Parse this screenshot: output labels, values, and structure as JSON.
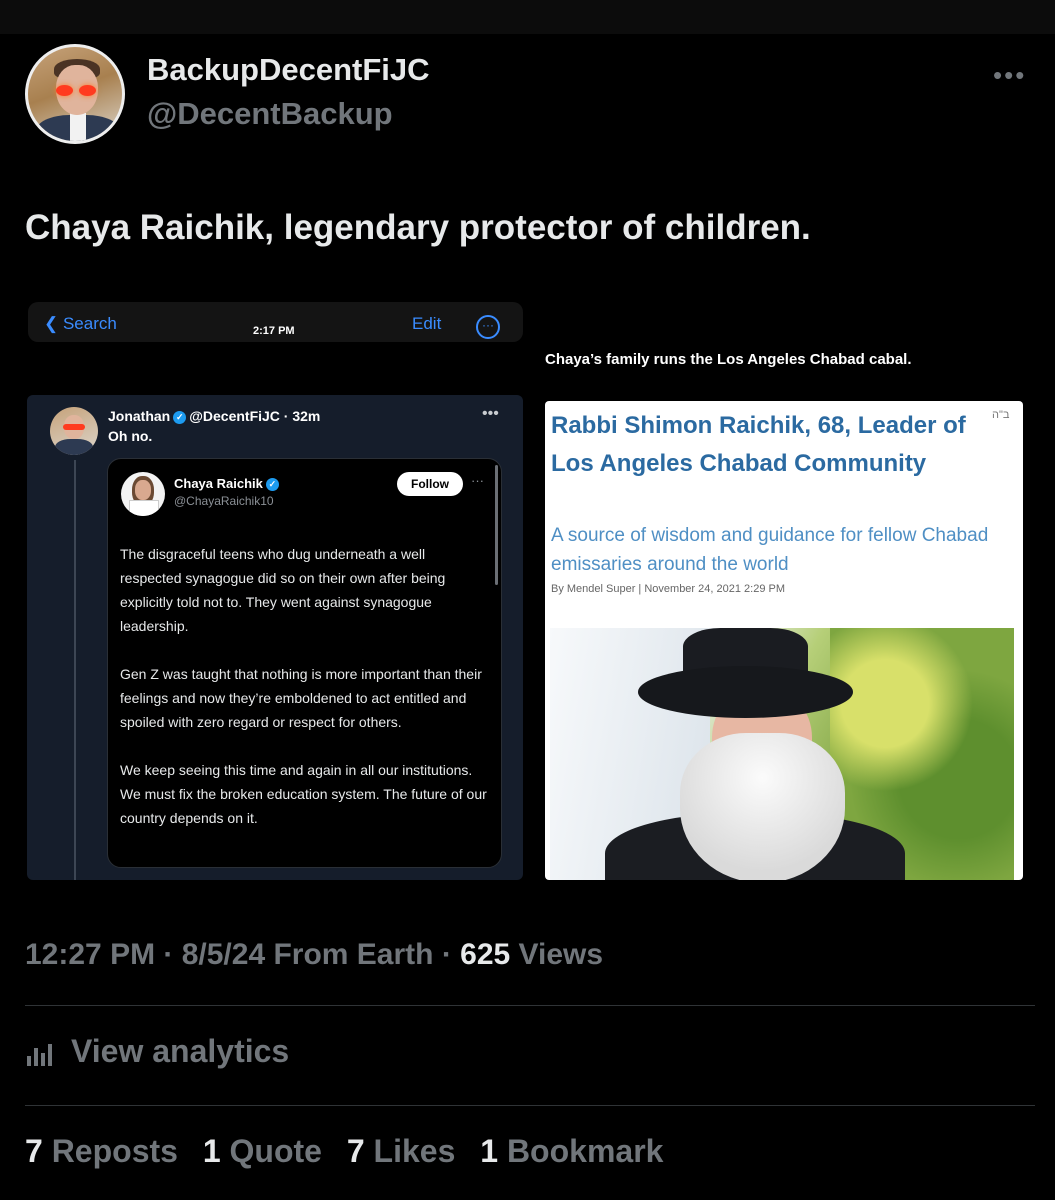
{
  "author": {
    "name": "BackupDecentFiJC",
    "handle": "@DecentBackup",
    "more_label": "•••"
  },
  "tweet": {
    "text": "Chaya Raichik, legendary protector of children."
  },
  "left_screenshot": {
    "ios_bar": {
      "back_label": "❮ Search",
      "time": "2:17 PM",
      "edit_label": "Edit",
      "more_label": "···"
    },
    "post": {
      "author": "Jonathan",
      "handle_time": "@DecentFiJC · 32m",
      "text": "Oh no.",
      "more_label": "•••",
      "quoted": {
        "name": "Chaya Raichik",
        "handle": "@ChayaRaichik10",
        "follow_label": "Follow",
        "more_label": "···",
        "paragraphs": [
          "The disgraceful teens who dug underneath a well respected synagogue did so on their own after being explicitly told not to. They went against synagogue leadership.",
          "Gen Z was taught that nothing is more important than their feelings and now they’re emboldened to act entitled and spoiled with zero regard or respect for others.",
          "We keep seeing this time and again in all our institutions. We must fix the broken education system. The future of our country depends on it."
        ]
      }
    }
  },
  "right_screenshot": {
    "caption": "Chaya’s family runs the Los Angeles Chabad cabal.",
    "article": {
      "title": "Rabbi Shimon Raichik, 68, Leader of Los Angeles Chabad Community",
      "mark": "ב\"ה",
      "subtitle": "A source of wisdom and guidance for fellow Chabad emissaries around the world",
      "byline": "By Mendel Super   |   November 24, 2021 2:29 PM"
    }
  },
  "meta": {
    "time_date_source": "12:27 PM · 8/5/24 From Earth · ",
    "views_count": "625",
    "views_label": " Views"
  },
  "analytics": {
    "label": "View analytics"
  },
  "stats": {
    "reposts_count": "7",
    "reposts_label": "Reposts",
    "quotes_count": "1",
    "quotes_label": "Quote",
    "likes_count": "7",
    "likes_label": "Likes",
    "bookmarks_count": "1",
    "bookmarks_label": "Bookmark"
  }
}
